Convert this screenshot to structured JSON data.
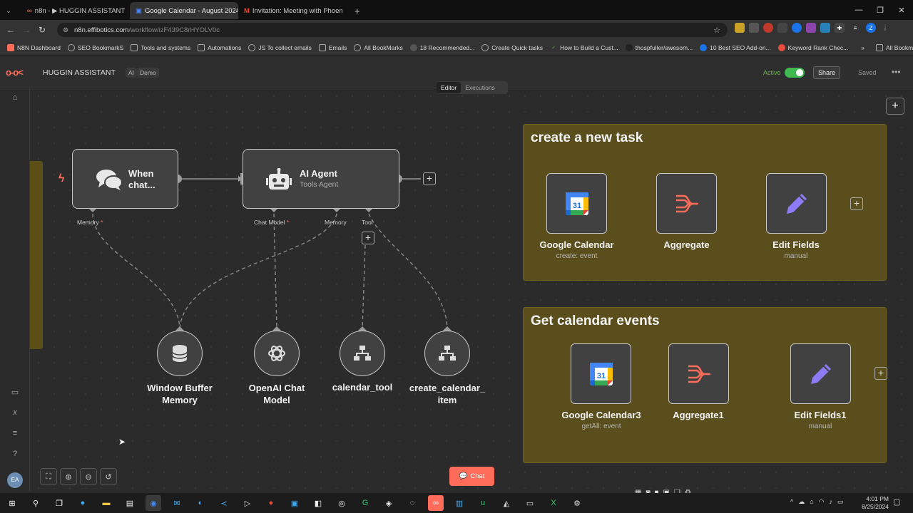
{
  "browser": {
    "tabs": [
      {
        "label": "n8n - ▶ HUGGIN ASSISTANT",
        "active": false
      },
      {
        "label": "Google Calendar - August 2024",
        "active": true
      },
      {
        "label": "Invitation: Meeting with Phoen",
        "active": false
      }
    ],
    "url_host": "n8n.effibotics.com",
    "url_path": "/workflow/izF439C8rHYOLV0c",
    "bookmarks": [
      "N8N Dashboard",
      "SEO BookmarkS",
      "Tools and systems",
      "Automations",
      "JS To collect emails",
      "Emails",
      "All BookMarks",
      "18 Recommended...",
      "Create Quick tasks",
      "How to Build a Cust...",
      "thospfuller/awesom...",
      "10 Best SEO Add-on...",
      "Keyword Rank Chec..."
    ],
    "all_bookmarks": "All Bookmarks",
    "profile_initial": "Z"
  },
  "header": {
    "workflow_name": "HUGGIN ASSISTANT",
    "tags": [
      "AI",
      "Demo"
    ],
    "active_label": "Active",
    "share_label": "Share",
    "saved_label": "Saved",
    "modes": [
      "Editor",
      "Executions"
    ]
  },
  "nodes": {
    "trigger": {
      "title": "When chat...",
      "title_line1": "When",
      "title_line2": "chat..."
    },
    "agent": {
      "title": "AI Agent",
      "subtitle": "Tools Agent"
    },
    "ports": {
      "trigger_memory": "Memory",
      "agent_chat_model": "Chat Model",
      "agent_memory": "Memory",
      "agent_tool": "Tool",
      "required_mark": "*"
    },
    "window_buffer": {
      "line1": "Window Buffer",
      "line2": "Memory"
    },
    "openai": {
      "line1": "OpenAI Chat",
      "line2": "Model"
    },
    "calendar_tool": {
      "line1": "calendar_tool"
    },
    "create_item": {
      "line1": "create_calendar_",
      "line2": "item"
    }
  },
  "sticky1": {
    "title": "create a new task",
    "nodes": [
      {
        "title": "Google Calendar",
        "subtitle": "create: event"
      },
      {
        "title": "Aggregate",
        "subtitle": ""
      },
      {
        "title": "Edit Fields",
        "subtitle": "manual"
      }
    ]
  },
  "sticky2": {
    "title": "Get calendar events",
    "nodes": [
      {
        "title": "Google Calendar3",
        "subtitle": "getAll: event"
      },
      {
        "title": "Aggregate1",
        "subtitle": ""
      },
      {
        "title": "Edit Fields1",
        "subtitle": "manual"
      }
    ]
  },
  "calendar_icon_day": "31",
  "chat_button": "Chat",
  "user_initials": "EA",
  "clock": {
    "time": "4:01 PM",
    "date": "8/25/2024"
  },
  "colors": {
    "accent": "#ff6d5a",
    "active": "#3fb950",
    "sticky": "#5a4f1c"
  }
}
